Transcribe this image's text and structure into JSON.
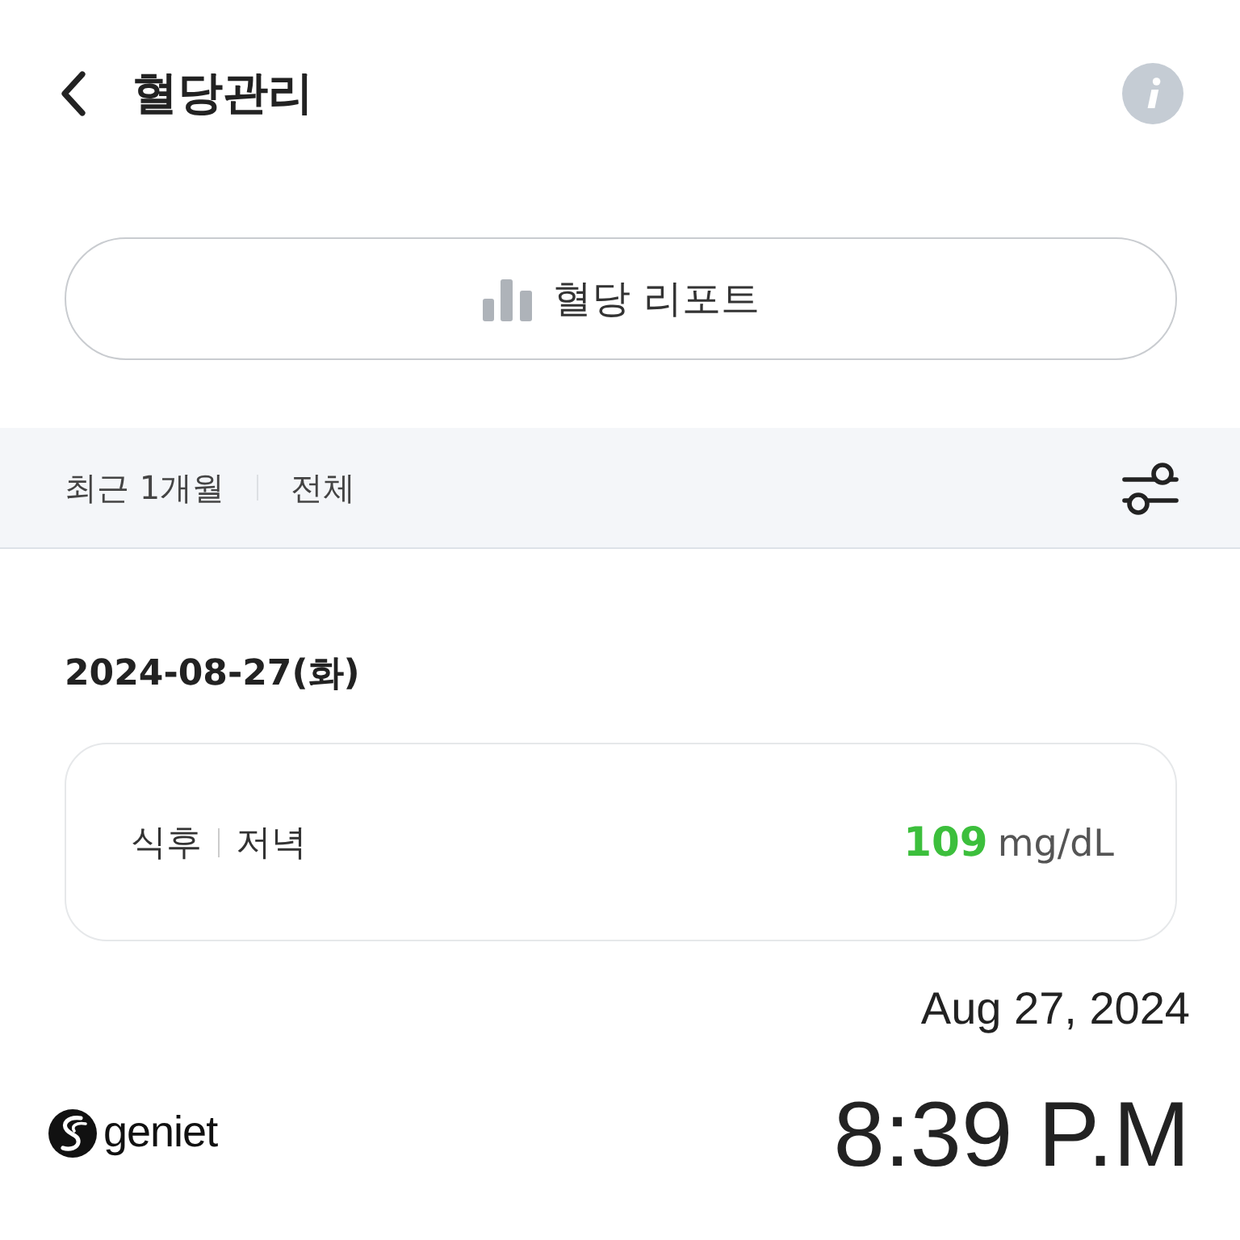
{
  "header": {
    "title": "혈당관리"
  },
  "report_button": {
    "label": "혈당 리포트"
  },
  "filters": [
    "최근 1개월",
    "전체"
  ],
  "records": [
    {
      "date": "2024-08-27(화)",
      "entries": [
        {
          "timing": "식후",
          "meal": "저녁",
          "value": "109",
          "unit": "mg/dL",
          "color": "#3cbf3c"
        }
      ]
    }
  ],
  "timestamp": {
    "date": "Aug 27, 2024",
    "time": "8:39 P.M",
    "logo": "geniet"
  }
}
